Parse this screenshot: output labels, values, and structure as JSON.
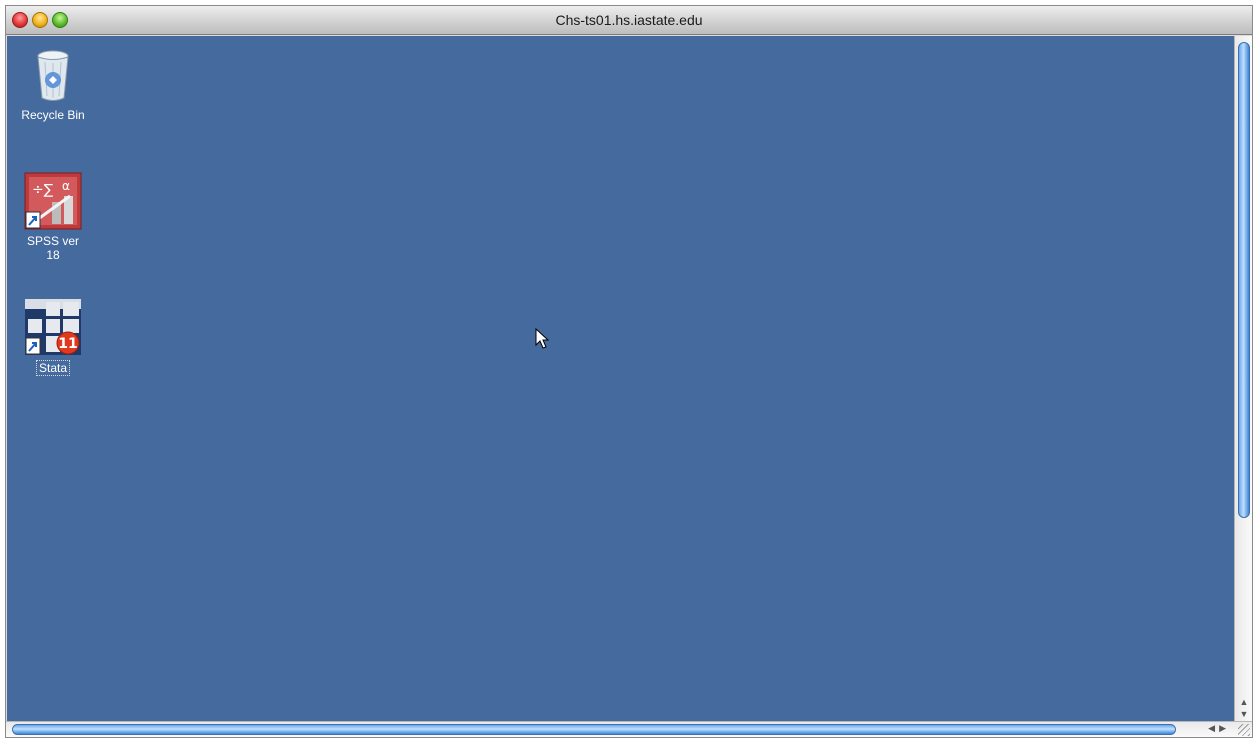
{
  "window": {
    "title": "Chs-ts01.hs.iastate.edu"
  },
  "desktop": {
    "background_color": "#456a9e",
    "icons": [
      {
        "label": "Recycle Bin",
        "icon": "recycle-bin-icon"
      },
      {
        "label": "SPSS ver 18",
        "icon": "spss-icon"
      },
      {
        "label": "Stata",
        "icon": "stata-icon",
        "selected": true
      }
    ]
  },
  "stata_badge": "11",
  "scrollbars": {
    "vertical": true,
    "horizontal": true
  }
}
